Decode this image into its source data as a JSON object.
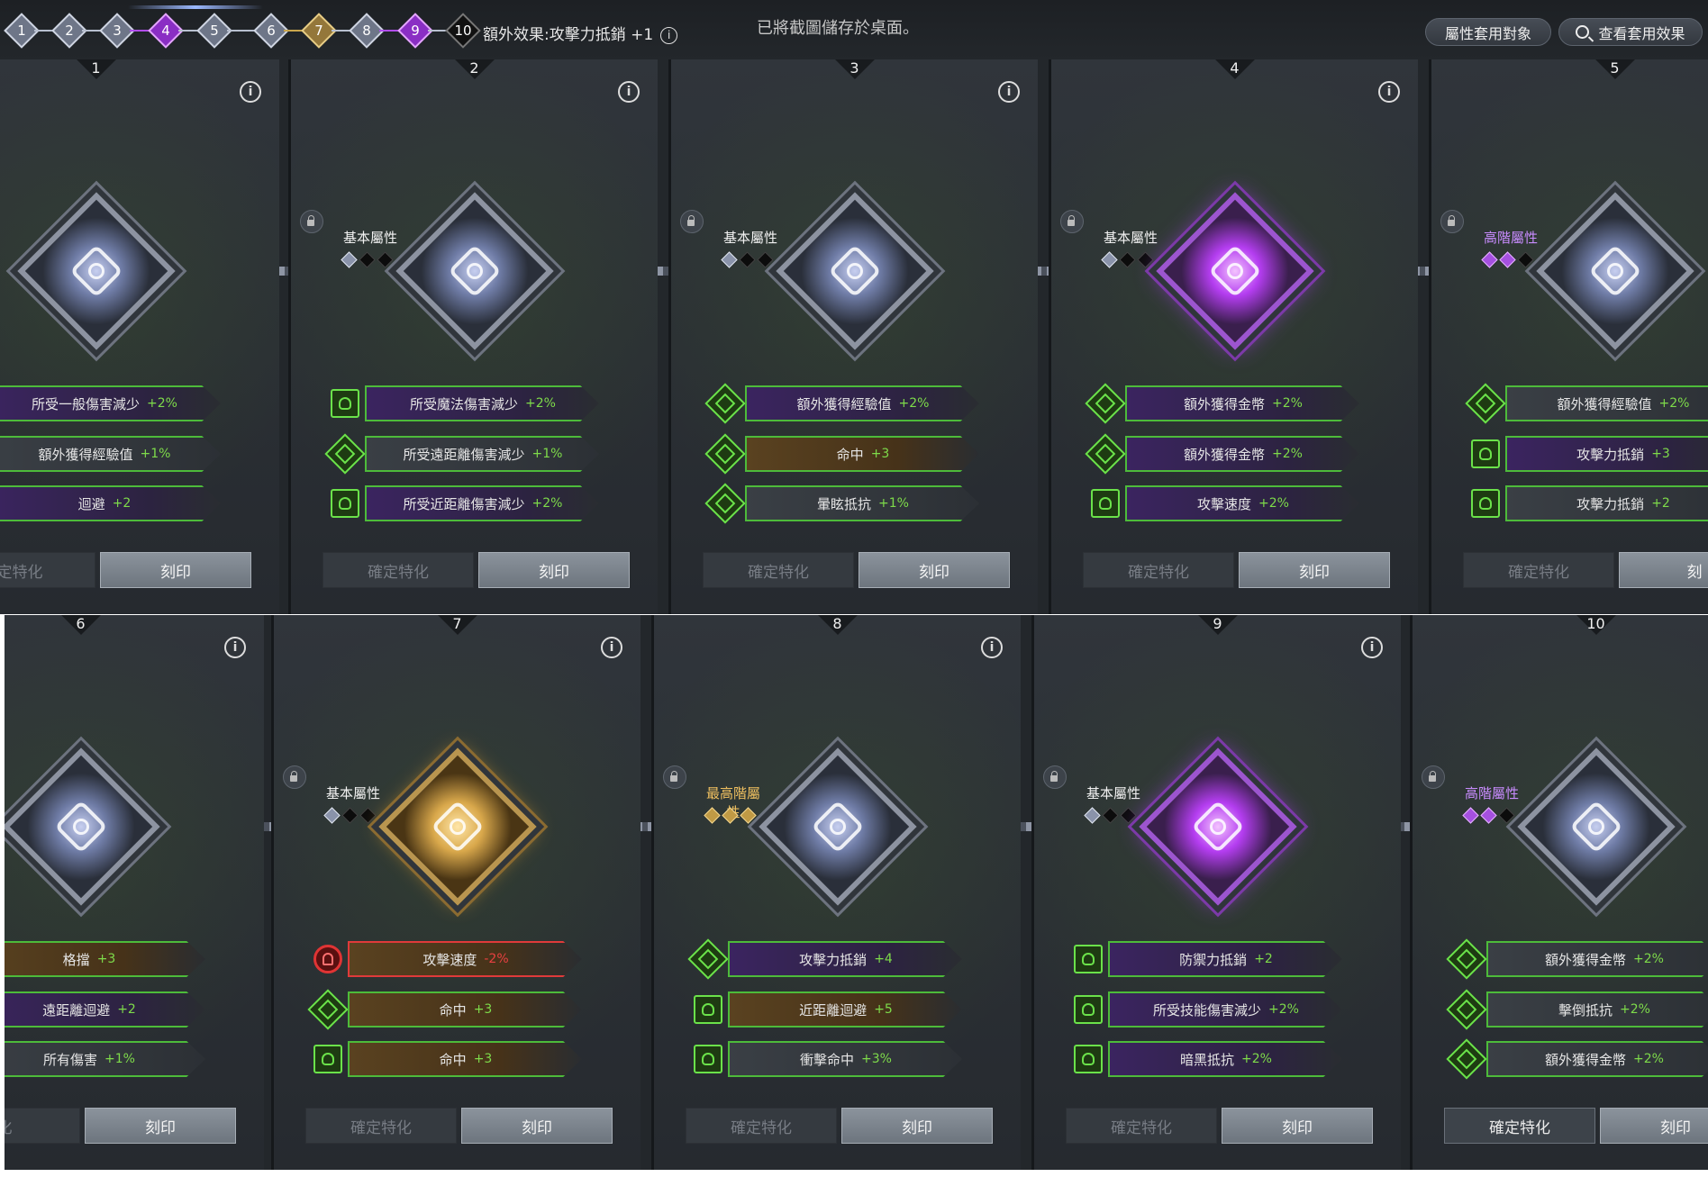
{
  "topbar": {
    "nodes": [
      {
        "label": "1",
        "style": "silver"
      },
      {
        "label": "2",
        "style": "silver"
      },
      {
        "label": "3",
        "style": "silver"
      },
      {
        "label": "4",
        "style": "purple"
      },
      {
        "label": "5",
        "style": "silver"
      },
      {
        "label": "6",
        "style": "silver"
      },
      {
        "label": "7",
        "style": "gold"
      },
      {
        "label": "8",
        "style": "silver"
      },
      {
        "label": "9",
        "style": "purple"
      },
      {
        "label": "10",
        "style": "dark"
      }
    ],
    "bonus_effect": "額外效果:攻擊力抵銷 +1",
    "info_icon": "i",
    "toast": "已將截圖儲存於桌面。",
    "attr_target_button": "屬性套用對象",
    "view_effect_button": "查看套用效果"
  },
  "panels_row1": [
    {
      "number": "1",
      "info": "i",
      "tier": "",
      "pips": [],
      "gem": "silver",
      "attrs": [
        {
          "name": "所受一般傷害減少",
          "value": "+2%",
          "icon": "",
          "bg": "purple",
          "border": "green"
        },
        {
          "name": "額外獲得經驗值",
          "value": "+1%",
          "icon": "",
          "bg": "plain",
          "border": "green"
        },
        {
          "name": "迴避",
          "value": "+2",
          "icon": "",
          "bg": "purple",
          "border": "green"
        }
      ],
      "confirm": "定特化",
      "engrave": "刻印",
      "confirm_active": false
    },
    {
      "number": "2",
      "info": "i",
      "tier": "基本屬性",
      "tier_style": "basic",
      "pips": [
        "silver",
        "dark",
        "dark"
      ],
      "gem": "silver",
      "attrs": [
        {
          "name": "所受魔法傷害減少",
          "value": "+2%",
          "icon": "square",
          "bg": "purple",
          "border": "green"
        },
        {
          "name": "所受遠距離傷害減少",
          "value": "+1%",
          "icon": "diamond",
          "bg": "plain",
          "border": "green"
        },
        {
          "name": "所受近距離傷害減少",
          "value": "+2%",
          "icon": "square",
          "bg": "purple",
          "border": "green"
        }
      ],
      "confirm": "確定特化",
      "engrave": "刻印",
      "confirm_active": false
    },
    {
      "number": "3",
      "info": "i",
      "tier": "基本屬性",
      "tier_style": "basic",
      "pips": [
        "silver",
        "dark",
        "dark"
      ],
      "gem": "silver",
      "attrs": [
        {
          "name": "額外獲得經驗值",
          "value": "+2%",
          "icon": "diamond",
          "bg": "purple",
          "border": "green"
        },
        {
          "name": "命中",
          "value": "+3",
          "icon": "diamond",
          "bg": "gold",
          "border": "green"
        },
        {
          "name": "暈眩抵抗",
          "value": "+1%",
          "icon": "diamond",
          "bg": "plain",
          "border": "green"
        }
      ],
      "confirm": "確定特化",
      "engrave": "刻印",
      "confirm_active": false
    },
    {
      "number": "4",
      "info": "i",
      "tier": "基本屬性",
      "tier_style": "basic",
      "pips": [
        "silver",
        "dark",
        "dark"
      ],
      "gem": "purple",
      "attrs": [
        {
          "name": "額外獲得金幣",
          "value": "+2%",
          "icon": "diamond",
          "bg": "purple",
          "border": "green"
        },
        {
          "name": "額外獲得金幣",
          "value": "+2%",
          "icon": "diamond",
          "bg": "purple",
          "border": "green"
        },
        {
          "name": "攻擊速度",
          "value": "+2%",
          "icon": "square",
          "bg": "purple",
          "border": "green"
        }
      ],
      "confirm": "確定特化",
      "engrave": "刻印",
      "confirm_active": false
    },
    {
      "number": "5",
      "info": "",
      "tier": "高階屬性",
      "tier_style": "adv",
      "pips": [
        "purple",
        "purple",
        "dark"
      ],
      "gem": "silver",
      "attrs": [
        {
          "name": "額外獲得經驗值",
          "value": "+2%",
          "icon": "diamond",
          "bg": "plain",
          "border": "green"
        },
        {
          "name": "攻擊力抵銷",
          "value": "+3",
          "icon": "square",
          "bg": "purple",
          "border": "green"
        },
        {
          "name": "攻擊力抵銷",
          "value": "+2",
          "icon": "square",
          "bg": "plain",
          "border": "green"
        }
      ],
      "confirm": "確定特化",
      "engrave": "刻",
      "confirm_active": false
    }
  ],
  "panels_row2": [
    {
      "number": "6",
      "info": "i",
      "tier": "",
      "pips": [],
      "gem": "silver",
      "attrs": [
        {
          "name": "格擋",
          "value": "+3",
          "icon": "",
          "bg": "gold",
          "border": "green"
        },
        {
          "name": "遠距離迴避",
          "value": "+2",
          "icon": "",
          "bg": "purple",
          "border": "green"
        },
        {
          "name": "所有傷害",
          "value": "+1%",
          "icon": "",
          "bg": "plain",
          "border": "green"
        }
      ],
      "confirm": "化",
      "engrave": "刻印",
      "confirm_active": false
    },
    {
      "number": "7",
      "info": "i",
      "tier": "基本屬性",
      "tier_style": "basic",
      "pips": [
        "silver",
        "dark",
        "dark"
      ],
      "gem": "gold",
      "attrs": [
        {
          "name": "攻擊速度",
          "value": "-2%",
          "icon": "circle-red",
          "bg": "gold",
          "border": "red"
        },
        {
          "name": "命中",
          "value": "+3",
          "icon": "diamond",
          "bg": "gold",
          "border": "green"
        },
        {
          "name": "命中",
          "value": "+3",
          "icon": "square",
          "bg": "gold",
          "border": "green"
        }
      ],
      "confirm": "確定特化",
      "engrave": "刻印",
      "confirm_active": false
    },
    {
      "number": "8",
      "info": "i",
      "tier": "最高階屬性",
      "tier_style": "top",
      "pips": [
        "gold",
        "gold",
        "gold"
      ],
      "gem": "silver",
      "attrs": [
        {
          "name": "攻擊力抵銷",
          "value": "+4",
          "icon": "diamond",
          "bg": "purple",
          "border": "green"
        },
        {
          "name": "近距離迴避",
          "value": "+5",
          "icon": "square",
          "bg": "gold",
          "border": "green"
        },
        {
          "name": "衝擊命中",
          "value": "+3%",
          "icon": "square",
          "bg": "plain",
          "border": "green"
        }
      ],
      "confirm": "確定特化",
      "engrave": "刻印",
      "confirm_active": false
    },
    {
      "number": "9",
      "info": "i",
      "tier": "基本屬性",
      "tier_style": "basic",
      "pips": [
        "silver",
        "dark",
        "dark"
      ],
      "gem": "purple",
      "attrs": [
        {
          "name": "防禦力抵銷",
          "value": "+2",
          "icon": "square",
          "bg": "purple",
          "border": "green"
        },
        {
          "name": "所受技能傷害減少",
          "value": "+2%",
          "icon": "square",
          "bg": "purple",
          "border": "green"
        },
        {
          "name": "暗黑抵抗",
          "value": "+2%",
          "icon": "square",
          "bg": "purple",
          "border": "green"
        }
      ],
      "confirm": "確定特化",
      "engrave": "刻印",
      "confirm_active": false
    },
    {
      "number": "10",
      "info": "",
      "tier": "高階屬性",
      "tier_style": "adv",
      "pips": [
        "purple",
        "purple",
        "dark"
      ],
      "gem": "silver",
      "attrs": [
        {
          "name": "額外獲得金幣",
          "value": "+2%",
          "icon": "diamond",
          "bg": "plain",
          "border": "green"
        },
        {
          "name": "擊倒抵抗",
          "value": "+2%",
          "icon": "diamond",
          "bg": "plain",
          "border": "green"
        },
        {
          "name": "額外獲得金幣",
          "value": "+2%",
          "icon": "diamond",
          "bg": "plain",
          "border": "green"
        }
      ],
      "confirm": "確定特化",
      "engrave": "刻印",
      "confirm_active": true
    }
  ]
}
